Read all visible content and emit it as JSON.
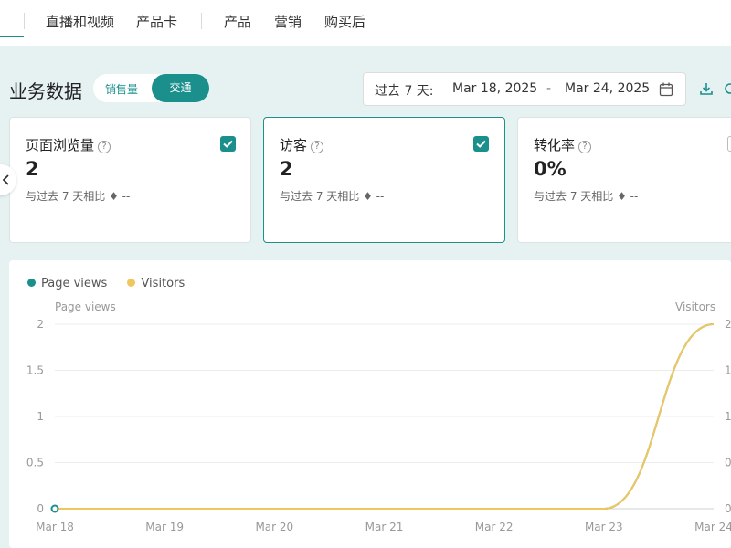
{
  "topnav": {
    "items": [
      "直播和视频",
      "产品卡",
      "产品",
      "营销",
      "购买后"
    ]
  },
  "header": {
    "title": "业务数据",
    "toggle": {
      "options": [
        "销售量",
        "交通"
      ],
      "selected": "交通"
    },
    "date_range": {
      "preset": "过去 7 天:",
      "start": "Mar 18, 2025",
      "separator": "-",
      "end": "Mar 24, 2025"
    }
  },
  "cards": [
    {
      "title": "页面浏览量",
      "value": "2",
      "compare": "与过去 7 天相比 ♦ --",
      "checked": true
    },
    {
      "title": "访客",
      "value": "2",
      "compare": "与过去 7 天相比 ♦ --",
      "checked": true
    },
    {
      "title": "转化率",
      "value": "0%",
      "compare": "与过去 7 天相比 ♦ --",
      "checked": false
    }
  ],
  "colors": {
    "accent": "#1a8f8b",
    "visitors": "#f0c75e",
    "page_views": "#1a8f8b"
  },
  "chart_data": {
    "type": "line",
    "x": [
      "Mar 18",
      "Mar 19",
      "Mar 20",
      "Mar 21",
      "Mar 22",
      "Mar 23",
      "Mar 24"
    ],
    "series": [
      {
        "name": "Page views",
        "values": [
          0,
          0,
          0,
          0,
          0,
          0,
          2
        ],
        "color": "#1a8f8b",
        "axis": "left"
      },
      {
        "name": "Visitors",
        "values": [
          0,
          0,
          0,
          0,
          0,
          0,
          2
        ],
        "color": "#f0c75e",
        "axis": "right"
      }
    ],
    "ylabel_left": "Page views",
    "ylabel_right": "Visitors",
    "ylim": [
      0,
      2
    ],
    "yticks": [
      "0",
      "0.5",
      "1",
      "1.5",
      "2"
    ],
    "legend": "top-left",
    "grid": true
  }
}
